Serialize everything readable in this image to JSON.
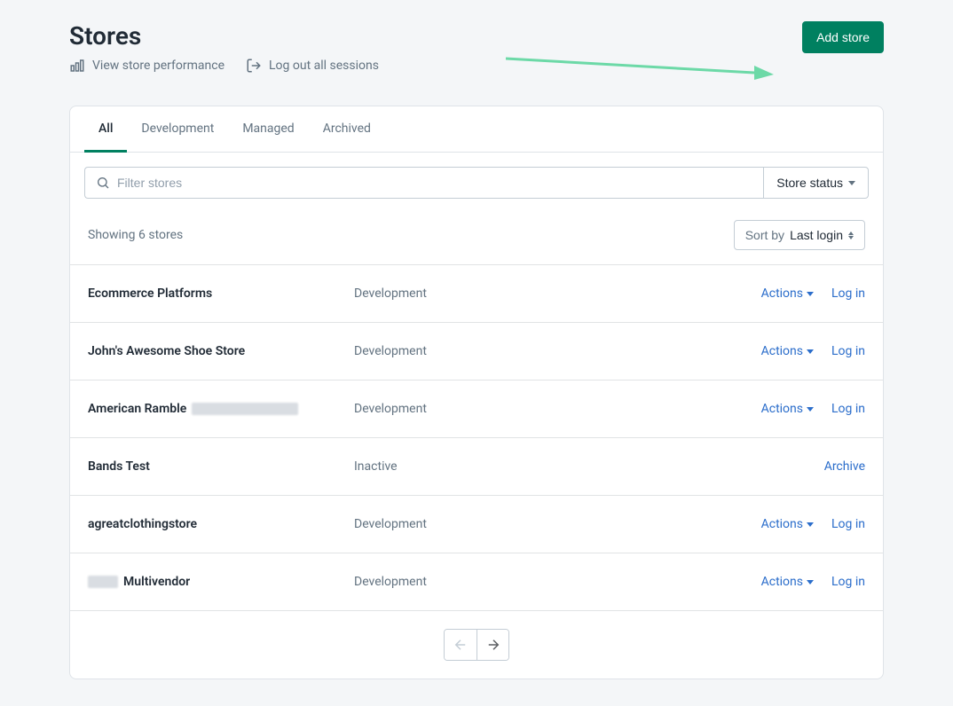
{
  "page": {
    "title": "Stores"
  },
  "header": {
    "view_performance": "View store performance",
    "logout_sessions": "Log out all sessions",
    "add_store": "Add store"
  },
  "tabs": {
    "all": "All",
    "development": "Development",
    "managed": "Managed",
    "archived": "Archived"
  },
  "filter": {
    "placeholder": "Filter stores",
    "status_label": "Store status"
  },
  "meta": {
    "showing": "Showing 6 stores",
    "sort_prefix": "Sort by",
    "sort_value": "Last login"
  },
  "actions_label": "Actions",
  "login_label": "Log in",
  "archive_label": "Archive",
  "stores": [
    {
      "name": "Ecommerce Platforms",
      "status": "Development",
      "has_actions": true,
      "name_obscured_prefix": false,
      "name_obscured_suffix": false
    },
    {
      "name": "John's Awesome Shoe Store",
      "status": "Development",
      "has_actions": true,
      "name_obscured_prefix": false,
      "name_obscured_suffix": false
    },
    {
      "name": "American Ramble",
      "status": "Development",
      "has_actions": true,
      "name_obscured_prefix": false,
      "name_obscured_suffix": true
    },
    {
      "name": "Bands Test",
      "status": "Inactive",
      "has_actions": false,
      "name_obscured_prefix": false,
      "name_obscured_suffix": false
    },
    {
      "name": "agreatclothingstore",
      "status": "Development",
      "has_actions": true,
      "name_obscured_prefix": false,
      "name_obscured_suffix": false
    },
    {
      "name": "Multivendor",
      "status": "Development",
      "has_actions": true,
      "name_obscured_prefix": true,
      "name_obscured_suffix": false
    }
  ],
  "colors": {
    "primary": "#008060",
    "link": "#2c6ecb",
    "annotation": "#6cd9a7"
  }
}
